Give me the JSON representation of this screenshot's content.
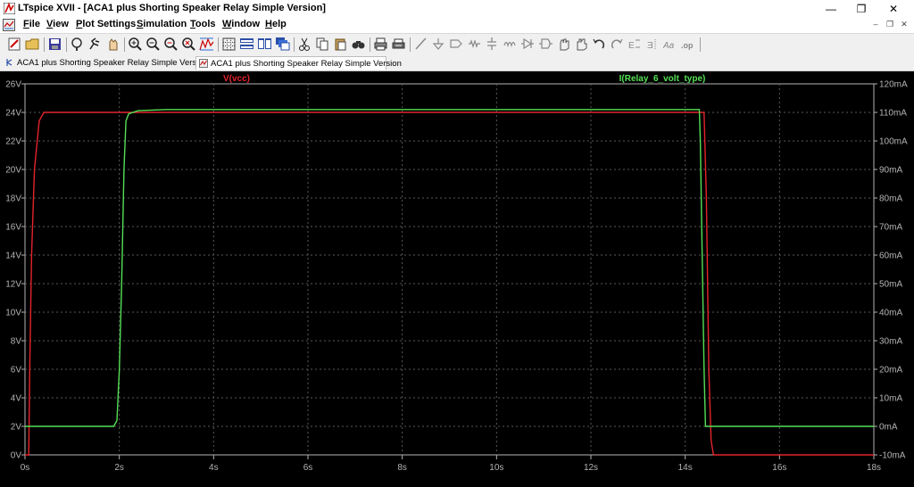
{
  "window": {
    "title": "LTspice XVII - [ACA1 plus Shorting Speaker Relay Simple Version]",
    "minimize_glyph": "—",
    "maximize_glyph": "❐",
    "close_glyph": "✕"
  },
  "menu": [
    "File",
    "View",
    "Plot Settings",
    "Simulation",
    "Tools",
    "Window",
    "Help"
  ],
  "mdi_controls": [
    "–",
    "❐",
    "✕"
  ],
  "toolbar_icons": [
    "new-schematic-icon",
    "open-folder-icon",
    "save-icon",
    "control-panel-icon",
    "run-icon",
    "halt-icon",
    "zoom-in-icon",
    "zoom-out-icon",
    "zoom-back-icon",
    "zoom-fit-icon",
    "autorange-icon",
    "toggle-grid-icon",
    "tile-horizontal-icon",
    "tile-vertical-icon",
    "cascade-icon",
    "cut-icon",
    "copy-icon",
    "paste-icon",
    "find-icon",
    "print-icon",
    "print-setup-icon",
    "wire-icon",
    "ground-icon",
    "label-icon",
    "resistor-icon",
    "capacitor-icon",
    "inductor-icon",
    "diode-icon",
    "component-icon",
    "move-icon",
    "drag-icon",
    "undo-icon",
    "redo-icon",
    "rotate-icon",
    "mirror-icon",
    "text-icon",
    "spice-directive-icon"
  ],
  "tabs": [
    {
      "label": "ACA1 plus Shorting Speaker Relay Simple Version",
      "icon": "schematic-tab-icon",
      "active": false
    },
    {
      "label": "ACA1 plus Shorting Speaker Relay Simple Version",
      "icon": "waveform-tab-icon",
      "active": true
    }
  ],
  "colors": {
    "plot_bg": "#000000",
    "grid": "#5a5a5a",
    "axis_text": "#b4b4b4",
    "trace_vcc": "#e3242b",
    "trace_relay": "#55e055"
  },
  "chart_data": {
    "type": "line",
    "title": "",
    "grid": true,
    "x": {
      "label": "",
      "unit": "s",
      "range": [
        0,
        18
      ],
      "ticks": [
        "0s",
        "2s",
        "4s",
        "6s",
        "8s",
        "10s",
        "12s",
        "14s",
        "16s",
        "18s"
      ]
    },
    "y_left": {
      "label": "",
      "unit": "V",
      "range": [
        0,
        26
      ],
      "ticks": [
        "0V",
        "2V",
        "4V",
        "6V",
        "8V",
        "10V",
        "12V",
        "14V",
        "16V",
        "18V",
        "20V",
        "22V",
        "24V",
        "26V"
      ]
    },
    "y_right": {
      "label": "",
      "unit": "mA",
      "range": [
        -10,
        120
      ],
      "ticks": [
        "-10mA",
        "0mA",
        "10mA",
        "20mA",
        "30mA",
        "40mA",
        "50mA",
        "60mA",
        "70mA",
        "80mA",
        "90mA",
        "100mA",
        "110mA",
        "120mA"
      ]
    },
    "series": [
      {
        "name": "V(vcc)",
        "axis": "left",
        "color": "#e3242b",
        "points": [
          [
            0,
            0
          ],
          [
            0.08,
            0
          ],
          [
            0.1,
            6
          ],
          [
            0.14,
            14
          ],
          [
            0.2,
            20
          ],
          [
            0.3,
            23.4
          ],
          [
            0.4,
            24
          ],
          [
            14.4,
            24
          ],
          [
            14.45,
            18
          ],
          [
            14.5,
            6
          ],
          [
            14.55,
            1
          ],
          [
            14.6,
            0
          ],
          [
            18,
            0
          ]
        ]
      },
      {
        "name": "I(Relay_6_volt_type)",
        "axis": "right",
        "color": "#55e055",
        "points": [
          [
            0,
            0
          ],
          [
            1.88,
            0
          ],
          [
            1.95,
            2
          ],
          [
            2.0,
            20
          ],
          [
            2.05,
            50
          ],
          [
            2.1,
            90
          ],
          [
            2.14,
            107
          ],
          [
            2.2,
            109.5
          ],
          [
            2.4,
            110.6
          ],
          [
            3.0,
            111
          ],
          [
            14.2,
            111
          ],
          [
            14.3,
            111
          ],
          [
            14.32,
            100
          ],
          [
            14.36,
            60
          ],
          [
            14.4,
            20
          ],
          [
            14.43,
            0
          ],
          [
            18,
            0
          ]
        ]
      }
    ]
  }
}
